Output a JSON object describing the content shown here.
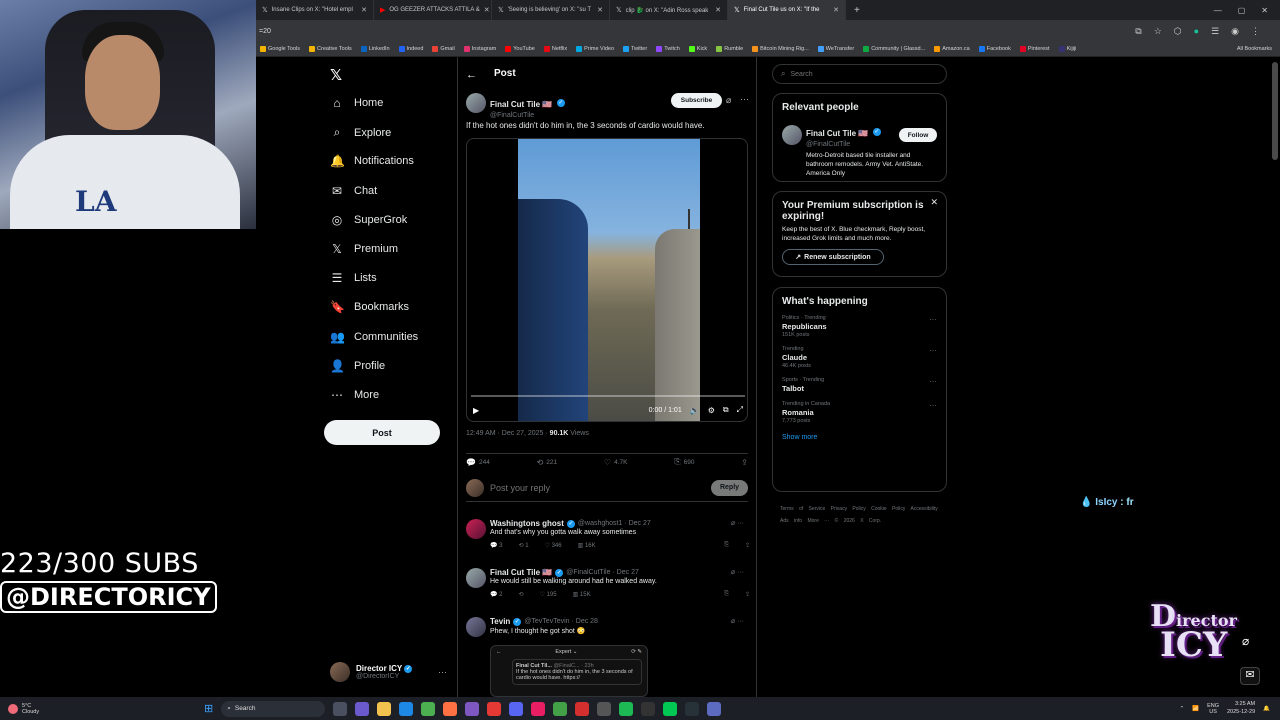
{
  "overlay": {
    "sub_count": "223/300 SUBS",
    "channel_handle": "@DIRECTORICY",
    "chat_nick": "IsIcy",
    "chat_text": " : fr",
    "watermark": "DIRECTOR ICY"
  },
  "browser": {
    "tabs": [
      {
        "label": "Insane Clips on X: \"Hotel empl",
        "icon": "x-icon"
      },
      {
        "label": "OG GEEZER ATTACKS ATTILA &",
        "icon": "youtube-icon"
      },
      {
        "label": "'Seeing is believing' on X: \"su T",
        "icon": "x-icon"
      },
      {
        "label": "clip 🐉 on X: \"Adin Ross speak",
        "icon": "x-icon"
      },
      {
        "label": "Final Cut Tile us on X: \"If the",
        "icon": "x-icon"
      }
    ],
    "url": "=20",
    "bookmarks": [
      "Google Tools",
      "Creative Tools",
      "LinkedIn",
      "Indeed",
      "Gmail",
      "Instagram",
      "YouTube",
      "Netflix",
      "Prime Video",
      "Twitter",
      "Twitch",
      "Kick",
      "Rumble",
      "Bitcoin Mining Rig...",
      "WeTransfer",
      "Community | Glassd...",
      "Amazon.ca",
      "Facebook",
      "Pinterest",
      "Kijiji"
    ],
    "all_bookmarks": "All Bookmarks"
  },
  "nav": {
    "items": [
      {
        "label": "Home",
        "icon": "⌂"
      },
      {
        "label": "Explore",
        "icon": "⌕"
      },
      {
        "label": "Notifications",
        "icon": "🔔"
      },
      {
        "label": "Chat",
        "icon": "✉"
      },
      {
        "label": "SuperGrok",
        "icon": "◎"
      },
      {
        "label": "Premium",
        "icon": "𝕏"
      },
      {
        "label": "Lists",
        "icon": "☰"
      },
      {
        "label": "Bookmarks",
        "icon": "🔖"
      },
      {
        "label": "Communities",
        "icon": "👥"
      },
      {
        "label": "Profile",
        "icon": "👤"
      },
      {
        "label": "More",
        "icon": "⋯"
      }
    ],
    "post_button": "Post",
    "user": {
      "name": "Director ICY",
      "handle": "@DirectorICY"
    }
  },
  "post": {
    "header_title": "Post",
    "author_name": "Final Cut Tile 🇺🇸",
    "author_handle": "@FinalCutTile",
    "subscribe_label": "Subscribe",
    "text": "If the hot ones didn't do him in, the 3 seconds of cardio would have.",
    "video_time": "0:00 / 1:01",
    "video_progress": 0.0,
    "timestamp": "12:49 AM · Dec 27, 2025 · ",
    "views_count": "90.1K",
    "views_label": " Views",
    "replies": "244",
    "reposts": "221",
    "likes": "4.7K",
    "bookmarks": "690",
    "reply_placeholder": "Post your reply",
    "reply_button": "Reply"
  },
  "replies": [
    {
      "name": "Washingtons ghost",
      "handle": "@washghost1 · Dec 27",
      "text": "And that's why you gotta walk away sometimes",
      "replies": "3",
      "reposts": "1",
      "likes": "346",
      "views": "16K"
    },
    {
      "name": "Final Cut Tile 🇺🇸",
      "handle": "@FinalCutTile · Dec 27",
      "text": "He would still be walking around had he walked away.",
      "replies": "2",
      "reposts": "",
      "likes": "195",
      "views": "15K"
    },
    {
      "name": "Tevin",
      "handle": "@TevTevTevin · Dec 28",
      "text": "Phew, I thought he got shot 😳",
      "replies": "",
      "reposts": "",
      "likes": "",
      "views": ""
    }
  ],
  "embed": {
    "header": "Expert ⌄",
    "name": "Final Cut Til...",
    "handle": "@FinalC... · 23h",
    "text": "If the hot ones didn't do him in, the 3 seconds of cardio would have. https://"
  },
  "right": {
    "search_placeholder": "Search",
    "relevant_title": "Relevant people",
    "relevant_name": "Final Cut Tile 🇺🇸",
    "relevant_handle": "@FinalCutTile",
    "follow_label": "Follow",
    "relevant_bio": "Metro-Detroit based tile installer and bathroom remodels. Army Vet. AntiState. America Only",
    "premium_title": "Your Premium subscription is expiring!",
    "premium_text": "Keep the best of X. Blue checkmark, Reply boost, increased Grok limits and much more.",
    "renew_label": "Renew subscription",
    "happening_title": "What's happening",
    "trends": [
      {
        "context": "Politics · Trending",
        "title": "Republicans",
        "count": "151K posts"
      },
      {
        "context": "Trending",
        "title": "Claude",
        "count": "46.4K posts"
      },
      {
        "context": "Sports · Trending",
        "title": "Talbot",
        "count": ""
      },
      {
        "context": "Trending in Canada",
        "title": "Romania",
        "count": "7,773 posts"
      }
    ],
    "show_more": "Show more",
    "footer": "Terms of Service  Privacy Policy  Cookie Policy  Accessibility  Ads info  More ···  © 2026 X Corp."
  },
  "taskbar": {
    "temp": "5°C",
    "weather": "Cloudy",
    "search": "Search",
    "lang": "ENG\nUS",
    "time": "3:25 AM",
    "date": "2025-12-29"
  },
  "colors": {
    "accent": "#1d9bf0",
    "bg": "#000000",
    "border": "#2f3336"
  }
}
